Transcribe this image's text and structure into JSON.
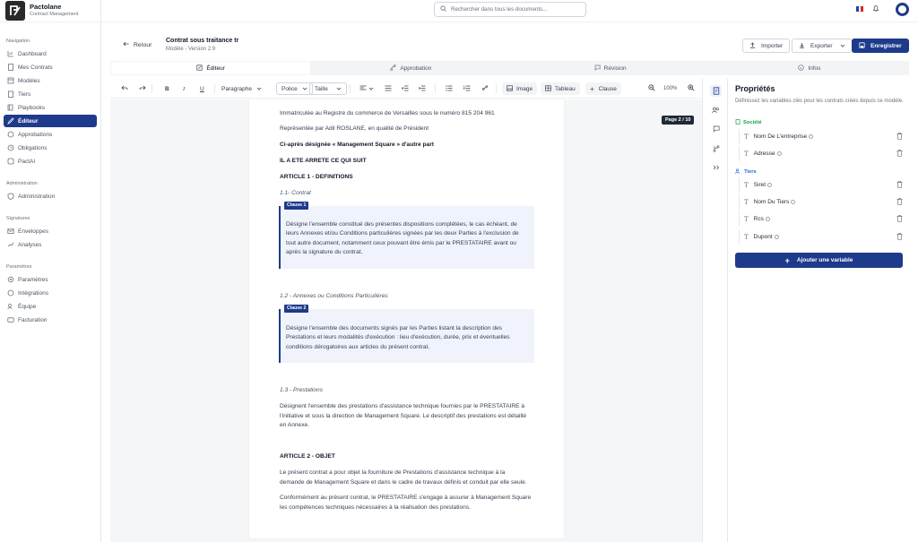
{
  "brand": {
    "name": "Pactolane",
    "subtitle": "Contract Management"
  },
  "search": {
    "placeholder": "Rechercher dans tous les documents..."
  },
  "sidebar": {
    "sections": [
      {
        "label": "Navigation",
        "items": [
          "Dashboard",
          "Mes Contrats",
          "Modèles",
          "Tiers",
          "Playbooks",
          "Éditeur",
          "Approbations",
          "Obligations",
          "PactAI"
        ]
      },
      {
        "label": "Administration",
        "items": [
          "Administration"
        ]
      },
      {
        "label": "Signatures",
        "items": [
          "Enveloppes",
          "Analyses"
        ]
      },
      {
        "label": "Paramètres",
        "items": [
          "Paramètres",
          "Intégrations",
          "Équipe",
          "Facturation"
        ]
      }
    ],
    "active": "Éditeur"
  },
  "header": {
    "back": "Retour",
    "title": "Contrat sous traitance tr",
    "subtitle": "Modèle - Version 2.9",
    "import": "Importer",
    "export": "Exporter",
    "save": "Enregistrer"
  },
  "tabs": [
    "Éditeur",
    "Approbation",
    "Révision",
    "Infos"
  ],
  "toolbar": {
    "paragraph": "Paragraphe",
    "font": "Police",
    "size": "Taille",
    "image": "Image",
    "table": "Tableau",
    "clause": "Clause",
    "zoom": "100%"
  },
  "document": {
    "page_indicator": "Page 2 / 10",
    "lines": [
      "Immatriculée au Registre du commerce de Versailles sous le numéro 815 204 961",
      "Représentée par Adil ROSLANE, en qualité de Président",
      "Ci-après désignée « Management Square » d'autre part",
      "IL A ETE ARRETE CE QUI SUIT",
      "ARTICLE 1 - DEFINITIONS",
      "1.1- Contrat"
    ],
    "clause1": {
      "tag": "Clause 1",
      "text": [
        "Désigne l'ensemble constitué des présentes dispositions complétées, le cas échéant, de",
        "leurs Annexes et/ou Conditions particulières signées par les deux Parties à l'exclusion de",
        "tout autre document, notamment ceux pouvant être émis par le PRESTATAIRE avant ou",
        "après la signature du contrat."
      ]
    },
    "sub2": "1.2 - Annexes ou Conditions Particulières",
    "clause2": {
      "tag": "Clause 2",
      "text": [
        "Désigne l'ensemble des documents signés par les Parties listant la description des",
        "Prestations et leurs modalités d'exécution : lieu d'exécution, durée, prix et éventuelles",
        "conditions dérogatoires aux articles du présent contrat."
      ]
    },
    "sub3": "1.3 - Prestations",
    "presta": [
      "Désignent l'ensemble des prestations d'assistance technique fournies par le PRESTATAIRE à",
      "l'initiative et sous la direction de Management Square. Le descriptif des prestations est détaillé",
      "en Annexe."
    ],
    "article2": "ARTICLE 2 - OBJET",
    "objet1": [
      "Le présent contrat a pour objet la fourniture de Prestations d'assistance technique à la",
      "demande de Management Square et dans le cadre de travaux définis et conduit par elle seule."
    ],
    "objet2": [
      "Conformément au présent contrat, le PRESTATAIRE s'engage à assurer à Management Square",
      "les compétences techniques nécessaires à la réalisation des prestations."
    ]
  },
  "panel": {
    "title": "Propriétés",
    "description": "Définissez les variables clés pour les contrats créés depuis ce modèle.",
    "groups": [
      {
        "label": "Société",
        "color": "#16a34a",
        "vars": [
          "Nom De L'entreprise",
          "Adresse"
        ]
      },
      {
        "label": "Tiers",
        "color": "#2563eb",
        "vars": [
          "Siret",
          "Nom Du Tiers",
          "Rcs",
          "Dupont"
        ]
      }
    ],
    "add_button": "Ajouter une variable"
  },
  "colors": {
    "primary": "#1e3a8a",
    "societe": "#16a34a",
    "tiers": "#2563eb"
  }
}
